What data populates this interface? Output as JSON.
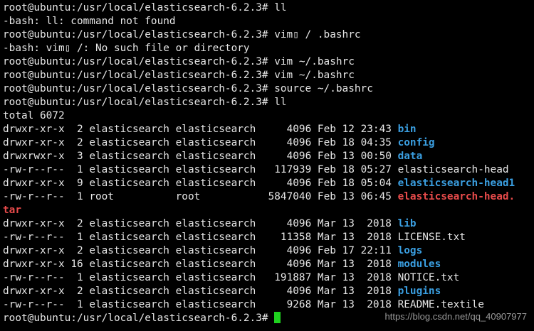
{
  "prompt": "root@ubuntu:/usr/local/elasticsearch-6.2.3#",
  "lines": [
    {
      "type": "cmd",
      "command": "ll"
    },
    {
      "type": "out",
      "text": "-bash: ll: command not found"
    },
    {
      "type": "cmd",
      "command": "vim▯ / .bashrc"
    },
    {
      "type": "out",
      "text": "-bash: vim▯ /: No such file or directory"
    },
    {
      "type": "cmd",
      "command": "vim ~/.bashrc"
    },
    {
      "type": "cmd",
      "command": "vim ~/.bashrc"
    },
    {
      "type": "cmd",
      "command": "source ~/.bashrc"
    },
    {
      "type": "cmd",
      "command": "ll"
    },
    {
      "type": "out",
      "text": "total 6072"
    },
    {
      "type": "file",
      "perms": "drwxr-xr-x",
      "links": "2",
      "owner": "elasticsearch",
      "group": "elasticsearch",
      "size": "4096",
      "month": "Feb",
      "day": "12",
      "time": "23:43",
      "name": "bin",
      "kind": "dir"
    },
    {
      "type": "file",
      "perms": "drwxr-xr-x",
      "links": "2",
      "owner": "elasticsearch",
      "group": "elasticsearch",
      "size": "4096",
      "month": "Feb",
      "day": "18",
      "time": "04:35",
      "name": "config",
      "kind": "dir"
    },
    {
      "type": "file",
      "perms": "drwxrwxr-x",
      "links": "3",
      "owner": "elasticsearch",
      "group": "elasticsearch",
      "size": "4096",
      "month": "Feb",
      "day": "13",
      "time": "00:50",
      "name": "data",
      "kind": "dir"
    },
    {
      "type": "file",
      "perms": "-rw-r--r--",
      "links": "1",
      "owner": "elasticsearch",
      "group": "elasticsearch",
      "size": "117939",
      "month": "Feb",
      "day": "18",
      "time": "05:27",
      "name": "elasticsearch-head",
      "kind": "file"
    },
    {
      "type": "file",
      "perms": "drwxr-xr-x",
      "links": "9",
      "owner": "elasticsearch",
      "group": "elasticsearch",
      "size": "4096",
      "month": "Feb",
      "day": "18",
      "time": "05:04",
      "name": "elasticsearch-head1",
      "kind": "dir"
    },
    {
      "type": "file",
      "perms": "-rw-r--r--",
      "links": "1",
      "owner": "root",
      "group": "root",
      "size": "5847040",
      "month": "Feb",
      "day": "13",
      "time": "06:45",
      "name": "elasticsearch-head.",
      "kind": "archive"
    },
    {
      "type": "wrap",
      "text": "tar",
      "kind": "archive"
    },
    {
      "type": "file",
      "perms": "drwxr-xr-x",
      "links": "2",
      "owner": "elasticsearch",
      "group": "elasticsearch",
      "size": "4096",
      "month": "Mar",
      "day": "13",
      "time": "2018",
      "name": "lib",
      "kind": "dir"
    },
    {
      "type": "file",
      "perms": "-rw-r--r--",
      "links": "1",
      "owner": "elasticsearch",
      "group": "elasticsearch",
      "size": "11358",
      "month": "Mar",
      "day": "13",
      "time": "2018",
      "name": "LICENSE.txt",
      "kind": "file"
    },
    {
      "type": "file",
      "perms": "drwxr-xr-x",
      "links": "2",
      "owner": "elasticsearch",
      "group": "elasticsearch",
      "size": "4096",
      "month": "Feb",
      "day": "17",
      "time": "22:11",
      "name": "logs",
      "kind": "dir"
    },
    {
      "type": "file",
      "perms": "drwxr-xr-x",
      "links": "16",
      "owner": "elasticsearch",
      "group": "elasticsearch",
      "size": "4096",
      "month": "Mar",
      "day": "13",
      "time": "2018",
      "name": "modules",
      "kind": "dir"
    },
    {
      "type": "file",
      "perms": "-rw-r--r--",
      "links": "1",
      "owner": "elasticsearch",
      "group": "elasticsearch",
      "size": "191887",
      "month": "Mar",
      "day": "13",
      "time": "2018",
      "name": "NOTICE.txt",
      "kind": "file"
    },
    {
      "type": "file",
      "perms": "drwxr-xr-x",
      "links": "2",
      "owner": "elasticsearch",
      "group": "elasticsearch",
      "size": "4096",
      "month": "Mar",
      "day": "13",
      "time": "2018",
      "name": "plugins",
      "kind": "dir"
    },
    {
      "type": "file",
      "perms": "-rw-r--r--",
      "links": "1",
      "owner": "elasticsearch",
      "group": "elasticsearch",
      "size": "9268",
      "month": "Mar",
      "day": "13",
      "time": "2018",
      "name": "README.textile",
      "kind": "file"
    },
    {
      "type": "cmd",
      "command": "",
      "cursor": true
    }
  ],
  "watermark": "https://blog.csdn.net/qq_40907977",
  "colors": {
    "background": "#000000",
    "text": "#e6e6e6",
    "directory": "#3a9ee0",
    "archive": "#e84b4b",
    "cursor": "#1fd11f",
    "watermark": "#9a9a9a"
  }
}
